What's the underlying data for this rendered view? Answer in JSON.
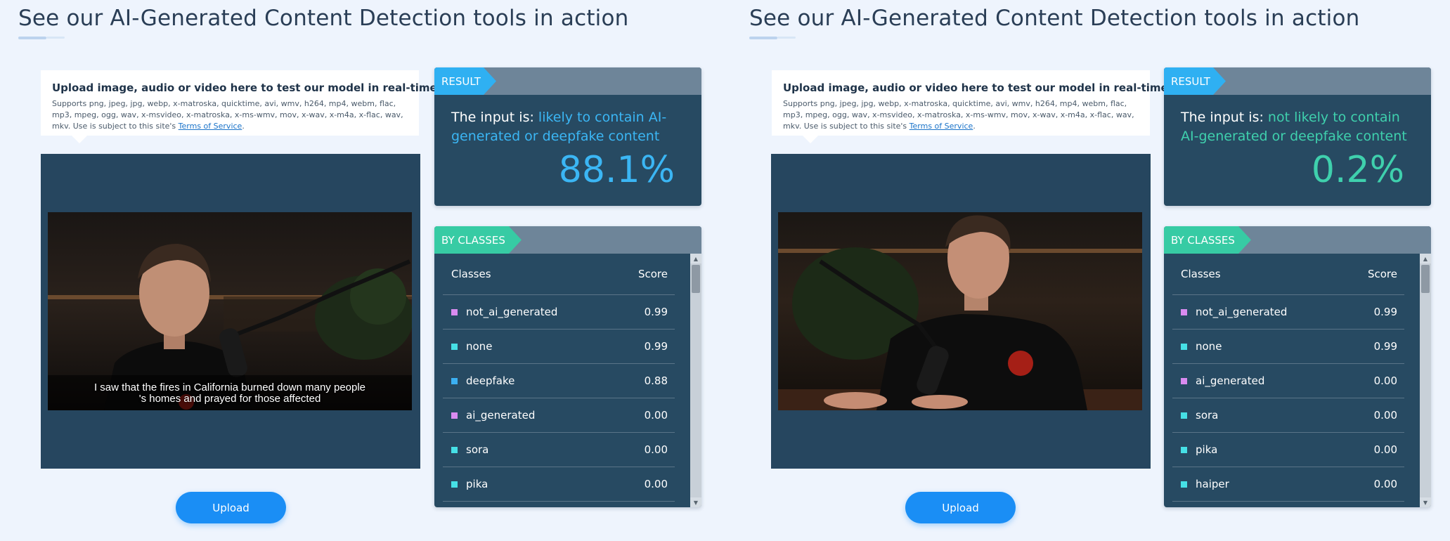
{
  "panels": [
    {
      "heading": "See our AI-Generated Content Detection tools in action",
      "upload_title": "Upload image, audio or video here to test our model in real-time!",
      "upload_desc": "Supports png, jpeg, jpg, webp, x-matroska, quicktime, avi, wmv, h264, mp4, webm, flac, mp3, mpeg, ogg, wav, x-msvideo, x-matroska, x-ms-wmv, mov, x-wav, x-m4a, x-flac, wav, mkv. Use is subject to this site's ",
      "tos_link": "Terms of Service",
      "tos_suffix": ".",
      "caption_line1": "I saw that the fires in California burned down many people",
      "caption_line2": "'s homes and prayed for those affected",
      "upload_button": "Upload",
      "result_tag": "RESULT",
      "result_prefix": "The input is: ",
      "result_verdict": "likely to contain AI-generated or deepfake content",
      "result_score": "88.1%",
      "classes_tag": "BY CLASSES",
      "col_classes": "Classes",
      "col_score": "Score",
      "rows": [
        {
          "name": "not_ai_generated",
          "score": "0.99",
          "color": "#d98bf0"
        },
        {
          "name": "none",
          "score": "0.99",
          "color": "#46e0e6"
        },
        {
          "name": "deepfake",
          "score": "0.88",
          "color": "#3bb0f2"
        },
        {
          "name": "ai_generated",
          "score": "0.00",
          "color": "#d98bf0"
        },
        {
          "name": "sora",
          "score": "0.00",
          "color": "#46e0e6"
        },
        {
          "name": "pika",
          "score": "0.00",
          "color": "#46e0e6"
        }
      ]
    },
    {
      "heading": "See our AI-Generated Content Detection tools in action",
      "upload_title": "Upload image, audio or video here to test our model in real-time!",
      "upload_desc": "Supports png, jpeg, jpg, webp, x-matroska, quicktime, avi, wmv, h264, mp4, webm, flac, mp3, mpeg, ogg, wav, x-msvideo, x-matroska, x-ms-wmv, mov, x-wav, x-m4a, x-flac, wav, mkv. Use is subject to this site's ",
      "tos_link": "Terms of Service",
      "tos_suffix": ".",
      "upload_button": "Upload",
      "result_tag": "RESULT",
      "result_prefix": "The input is: ",
      "result_verdict": "not likely to contain AI-generated or deepfake content",
      "result_score": "0.2%",
      "classes_tag": "BY CLASSES",
      "col_classes": "Classes",
      "col_score": "Score",
      "rows": [
        {
          "name": "not_ai_generated",
          "score": "0.99",
          "color": "#d98bf0"
        },
        {
          "name": "none",
          "score": "0.99",
          "color": "#46e0e6"
        },
        {
          "name": "ai_generated",
          "score": "0.00",
          "color": "#d98bf0"
        },
        {
          "name": "sora",
          "score": "0.00",
          "color": "#46e0e6"
        },
        {
          "name": "pika",
          "score": "0.00",
          "color": "#46e0e6"
        },
        {
          "name": "haiper",
          "score": "0.00",
          "color": "#46e0e6"
        }
      ]
    }
  ],
  "colors": {
    "accent_blue": "#3bb6f4",
    "accent_green": "#3fd0ad",
    "card_bg": "#274a62",
    "button_blue": "#1a8ef5"
  }
}
